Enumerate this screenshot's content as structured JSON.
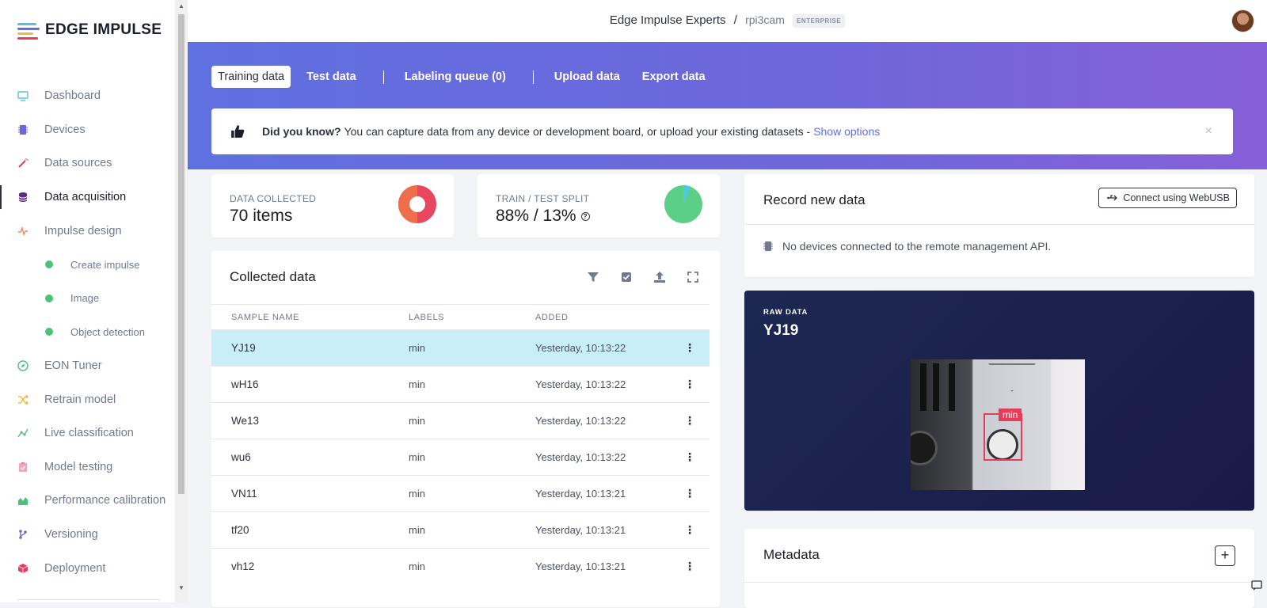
{
  "brand": {
    "name": "EDGE IMPULSE"
  },
  "sidebar": {
    "items": [
      {
        "label": "Dashboard",
        "icon": "monitor-icon",
        "color": "#5bc0de"
      },
      {
        "label": "Devices",
        "icon": "chip-icon",
        "color": "#6f66db"
      },
      {
        "label": "Data sources",
        "icon": "wand-icon",
        "color": "#e53d5a"
      },
      {
        "label": "Data acquisition",
        "icon": "database-icon",
        "color": "#5b2a86"
      },
      {
        "label": "Impulse design",
        "icon": "pulse-icon",
        "color": "#f08a5d"
      },
      {
        "label": "Create impulse",
        "sub": true
      },
      {
        "label": "Image",
        "sub": true
      },
      {
        "label": "Object detection",
        "sub": true
      },
      {
        "label": "EON Tuner",
        "icon": "compass-icon",
        "color": "#4bc27a"
      },
      {
        "label": "Retrain model",
        "icon": "shuffle-icon",
        "color": "#f0b93a"
      },
      {
        "label": "Live classification",
        "icon": "graph-icon",
        "color": "#4bc27a"
      },
      {
        "label": "Model testing",
        "icon": "clipboard-icon",
        "color": "#f4a6b8"
      },
      {
        "label": "Performance calibration",
        "icon": "chart-icon",
        "color": "#4bc27a"
      },
      {
        "label": "Versioning",
        "icon": "branch-icon",
        "color": "#6f66db"
      },
      {
        "label": "Deployment",
        "icon": "box-icon",
        "color": "#e53d5a"
      }
    ]
  },
  "header": {
    "org": "Edge Impulse Experts",
    "separator": "/",
    "project": "rpi3cam",
    "badge": "ENTERPRISE"
  },
  "tabs": {
    "training": "Training data",
    "test": "Test data",
    "labeling": "Labeling queue (0)",
    "upload": "Upload data",
    "export": "Export data"
  },
  "tip": {
    "bold": "Did you know?",
    "text": "You can capture data from any device or development board, or upload your existing datasets -",
    "link": "Show options",
    "close": "×"
  },
  "stats": {
    "collected_label": "DATA COLLECTED",
    "collected_value": "70 items",
    "split_label": "TRAIN / TEST SPLIT",
    "split_value": "88% / 13%",
    "split_help": "?"
  },
  "collected": {
    "title": "Collected data",
    "columns": [
      "SAMPLE NAME",
      "LABELS",
      "ADDED"
    ],
    "rows": [
      {
        "name": "YJ19",
        "label": "min",
        "added": "Yesterday, 10:13:22"
      },
      {
        "name": "wH16",
        "label": "min",
        "added": "Yesterday, 10:13:22"
      },
      {
        "name": "We13",
        "label": "min",
        "added": "Yesterday, 10:13:22"
      },
      {
        "name": "wu6",
        "label": "min",
        "added": "Yesterday, 10:13:22"
      },
      {
        "name": "VN11",
        "label": "min",
        "added": "Yesterday, 10:13:21"
      },
      {
        "name": "tf20",
        "label": "min",
        "added": "Yesterday, 10:13:21"
      },
      {
        "name": "vh12",
        "label": "min",
        "added": "Yesterday, 10:13:21"
      }
    ]
  },
  "record": {
    "title": "Record new data",
    "button": "Connect using WebUSB",
    "status": "No devices connected to the remote management API."
  },
  "raw": {
    "tag": "RAW DATA",
    "name": "YJ19",
    "bbox_label": "min"
  },
  "metadata": {
    "title": "Metadata",
    "add": "+"
  },
  "colors": {
    "accent": "#5f70e0",
    "selected_row": "#c9eef7",
    "bbox": "#e53d5a",
    "green": "#4bc27a"
  }
}
